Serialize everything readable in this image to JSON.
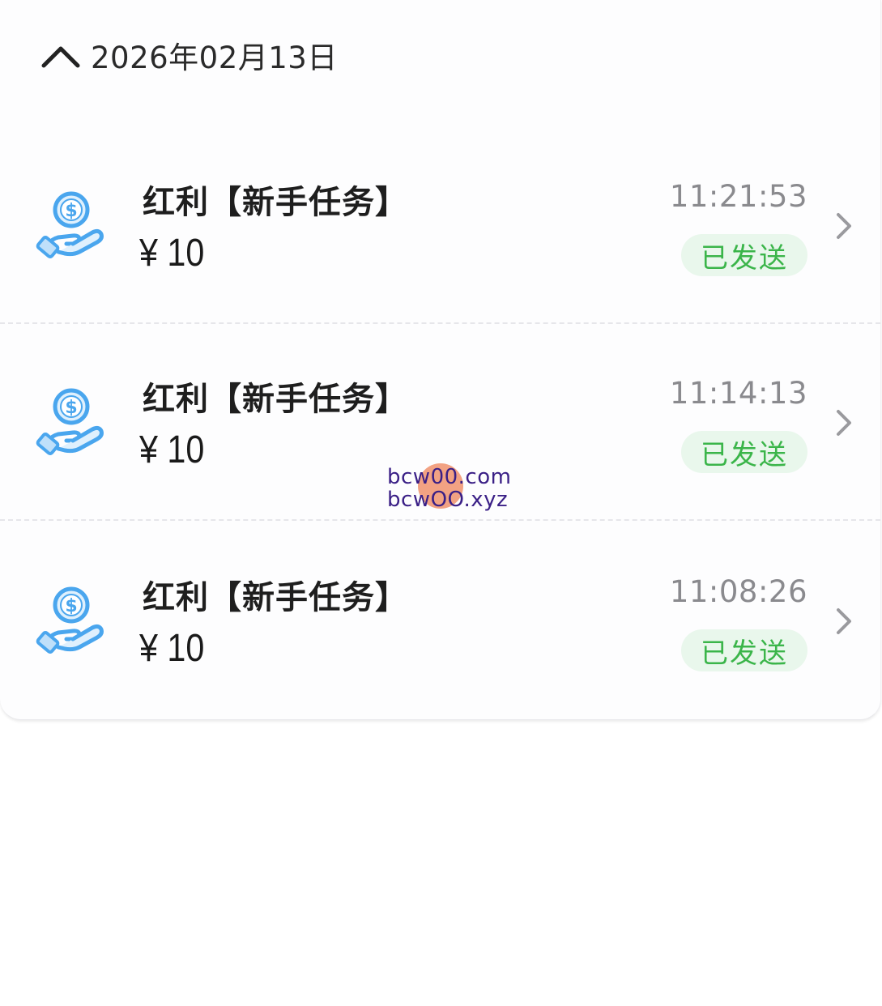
{
  "header": {
    "date": "2026年02月13日",
    "collapse_icon": "chevron-up-icon"
  },
  "records": [
    {
      "title": "红利【新手任务】",
      "amount": "¥ 10",
      "time": "11:21:53",
      "status": "已发送",
      "icon": "coin-hand-icon"
    },
    {
      "title": "红利【新手任务】",
      "amount": "¥ 10",
      "time": "11:14:13",
      "status": "已发送",
      "icon": "coin-hand-icon"
    },
    {
      "title": "红利【新手任务】",
      "amount": "¥ 10",
      "time": "11:08:26",
      "status": "已发送",
      "icon": "coin-hand-icon"
    }
  ],
  "watermark": {
    "line1": "bcw00.com",
    "line2": "bcwOO.xyz"
  },
  "colors": {
    "status_text": "#3bb54a",
    "status_bg": "#e9f7ec",
    "icon_blue": "#4aa6ee",
    "time_gray": "#8a8a8e"
  }
}
